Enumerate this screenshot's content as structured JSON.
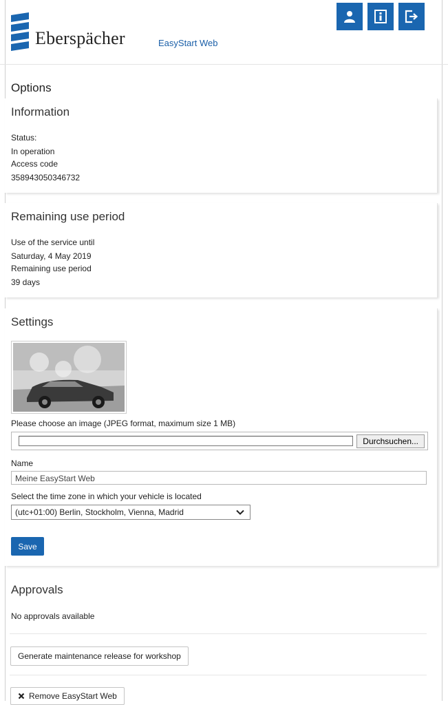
{
  "header": {
    "brand": "Eberspächer",
    "app_name": "EasyStart Web",
    "buttons": [
      {
        "icon": "user-icon"
      },
      {
        "icon": "info-icon"
      },
      {
        "icon": "logout-icon"
      }
    ],
    "accent_color": "#1a66b0"
  },
  "page": {
    "title": "Options"
  },
  "information": {
    "title": "Information",
    "status_label": "Status:",
    "status_value": "In operation",
    "access_label": "Access code",
    "access_value": "358943050346732"
  },
  "remaining": {
    "title": "Remaining use period",
    "service_label": "Use of the service until",
    "service_value": "Saturday, 4 May 2019",
    "period_label": "Remaining use period",
    "period_value": "39 days"
  },
  "settings": {
    "title": "Settings",
    "image_hint": "Please choose an image (JPEG format, maximum size 1 MB)",
    "browse_label": "Durchsuchen...",
    "name_label": "Name",
    "name_value": "Meine EasyStart Web",
    "timezone_label": "Select the time zone in which your vehicle is located",
    "timezone_value": "(utc+01:00) Berlin, Stockholm, Vienna, Madrid",
    "save_label": "Save"
  },
  "approvals": {
    "title": "Approvals",
    "empty_text": "No approvals available",
    "generate_label": "Generate maintenance release for workshop"
  },
  "remove": {
    "label": "Remove EasyStart Web"
  }
}
